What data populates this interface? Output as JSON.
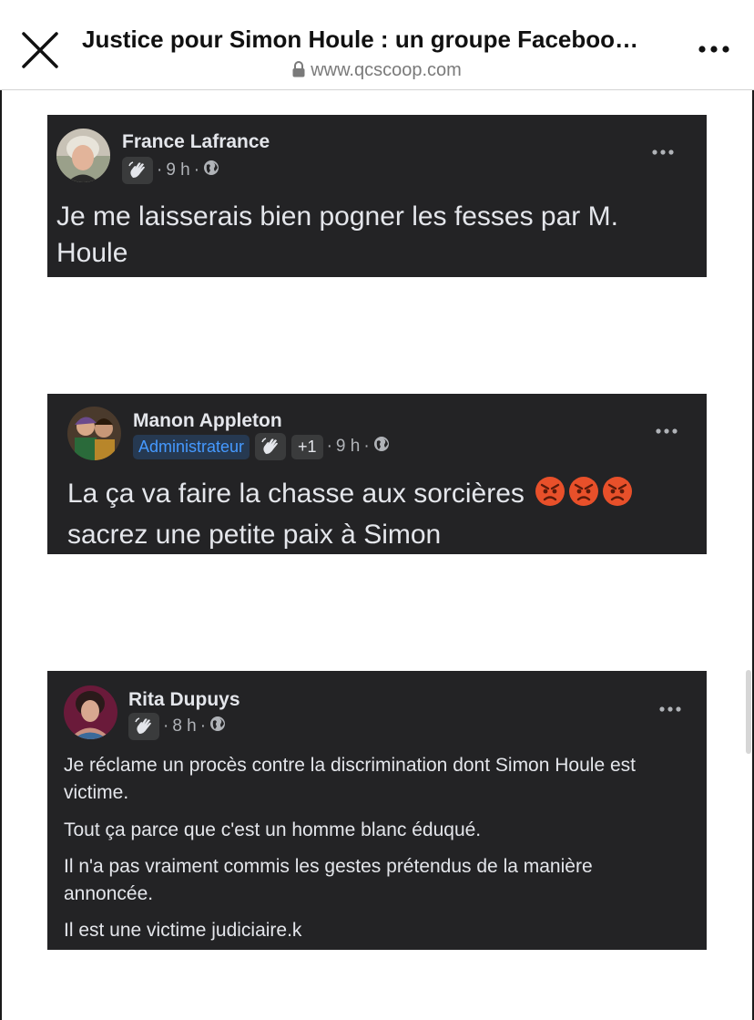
{
  "header": {
    "title": "Justice pour Simon Houle : un groupe Faceboo…",
    "url": "www.qcscoop.com",
    "close_icon": "close-icon",
    "lock_icon": "lock-icon",
    "more_icon": "more-horizontal-icon"
  },
  "posts": [
    {
      "author": "France Lafrance",
      "badge_icon": "wave-hand-icon",
      "time": "9 h",
      "separator": "·",
      "privacy_icon": "globe-icon",
      "text": "Je me laisserais bien pogner les fesses par M. Houle"
    },
    {
      "author": "Manon Appleton",
      "role": "Administrateur",
      "badge_icon": "wave-hand-icon",
      "extra_badges": "+1",
      "time": "9 h",
      "separator": "·",
      "privacy_icon": "globe-icon",
      "text_line1": "La ça va faire la chasse aux sorcières",
      "emojis": [
        "angry-face-emoji",
        "angry-face-emoji",
        "angry-face-emoji"
      ],
      "text_line2": "sacrez une petite paix à Simon"
    },
    {
      "author": "Rita Dupuys",
      "badge_icon": "wave-hand-icon",
      "time": "8 h",
      "separator": "·",
      "privacy_icon": "globe-icon",
      "paragraphs": [
        "Je réclame un procès contre la discrimination dont Simon Houle est victime.",
        "Tout ça parce que c'est un homme blanc éduqué.",
        "Il n'a pas vraiment commis les gestes prétendus de la manière annoncée.",
        "Il est une victime judiciaire.k"
      ]
    }
  ],
  "colors": {
    "post_background": "#232325",
    "post_text": "#e4e6eb",
    "meta_text": "#b0b3b8",
    "admin_badge_text": "#4599ff",
    "admin_badge_bg": "#263951"
  }
}
